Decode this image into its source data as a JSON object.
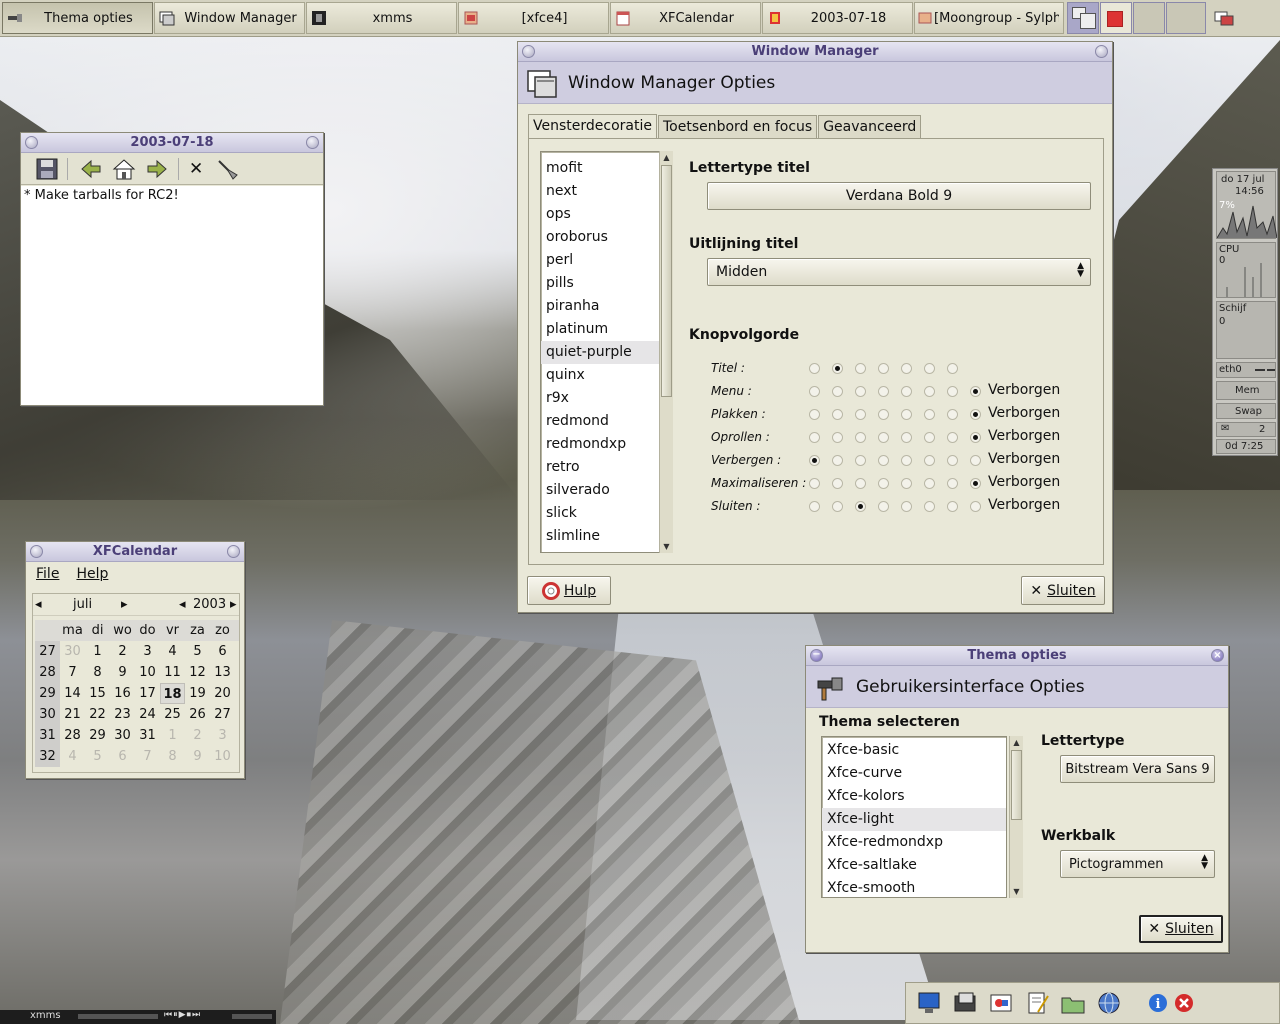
{
  "taskbar": {
    "tasks": [
      {
        "label": "Thema opties",
        "active": true
      },
      {
        "label": "Window Manager",
        "active": false
      },
      {
        "label": "xmms",
        "active": false
      },
      {
        "label": "[xfce4]",
        "active": false
      },
      {
        "label": "XFCalendar",
        "active": false
      },
      {
        "label": "2003-07-18",
        "active": false
      },
      {
        "label": "[Moongroup - Sylphe",
        "active": false
      }
    ]
  },
  "notes_window": {
    "title": "2003-07-18",
    "content": "* Make tarballs for RC2!"
  },
  "wm_window": {
    "title": "Window Manager",
    "header": "Window Manager Opties",
    "tabs": [
      "Vensterdecoratie",
      "Toetsenbord en focus",
      "Geavanceerd"
    ],
    "themes": [
      "mofit",
      "next",
      "ops",
      "oroborus",
      "perl",
      "pills",
      "piranha",
      "platinum",
      "quiet-purple",
      "quinx",
      "r9x",
      "redmond",
      "redmondxp",
      "retro",
      "silverado",
      "slick",
      "slimline"
    ],
    "selected_theme": "quiet-purple",
    "font_title_label": "Lettertype titel",
    "font_value": "Verdana Bold 9",
    "align_label": "Uitlijning titel",
    "align_value": "Midden",
    "button_order_label": "Knopvolgorde",
    "button_rows": [
      {
        "label": "Titel :",
        "selected": 1,
        "hidden_option": false
      },
      {
        "label": "Menu :",
        "selected": 7,
        "hidden_option": true
      },
      {
        "label": "Plakken :",
        "selected": 7,
        "hidden_option": true
      },
      {
        "label": "Oprollen :",
        "selected": 7,
        "hidden_option": true
      },
      {
        "label": "Verbergen :",
        "selected": 0,
        "hidden_option": true
      },
      {
        "label": "Maximaliseren :",
        "selected": 7,
        "hidden_option": true
      },
      {
        "label": "Sluiten :",
        "selected": 2,
        "hidden_option": true
      }
    ],
    "hidden_text": "Verborgen",
    "help_button": "Hulp",
    "close_button": "Sluiten"
  },
  "calendar_window": {
    "title": "XFCalendar",
    "menu": [
      "File",
      "Help"
    ],
    "month": "juli",
    "year": "2003",
    "weekday_headers": [
      "ma",
      "di",
      "wo",
      "do",
      "vr",
      "za",
      "zo"
    ],
    "weeks": [
      {
        "wk": "27",
        "days": [
          "30",
          "1",
          "2",
          "3",
          "4",
          "5",
          "6"
        ],
        "dim": [
          true,
          false,
          false,
          false,
          false,
          false,
          false
        ]
      },
      {
        "wk": "28",
        "days": [
          "7",
          "8",
          "9",
          "10",
          "11",
          "12",
          "13"
        ],
        "dim": [
          false,
          false,
          false,
          false,
          false,
          false,
          false
        ]
      },
      {
        "wk": "29",
        "days": [
          "14",
          "15",
          "16",
          "17",
          "18",
          "19",
          "20"
        ],
        "dim": [
          false,
          false,
          false,
          false,
          false,
          false,
          false
        ]
      },
      {
        "wk": "30",
        "days": [
          "21",
          "22",
          "23",
          "24",
          "25",
          "26",
          "27"
        ],
        "dim": [
          false,
          false,
          false,
          false,
          false,
          false,
          false
        ]
      },
      {
        "wk": "31",
        "days": [
          "28",
          "29",
          "30",
          "31",
          "1",
          "2",
          "3"
        ],
        "dim": [
          false,
          false,
          false,
          false,
          true,
          true,
          true
        ]
      },
      {
        "wk": "32",
        "days": [
          "4",
          "5",
          "6",
          "7",
          "8",
          "9",
          "10"
        ],
        "dim": [
          true,
          true,
          true,
          true,
          true,
          true,
          true
        ]
      }
    ],
    "today": "18"
  },
  "theme_window": {
    "title": "Thema opties",
    "header": "Gebruikersinterface Opties",
    "select_label": "Thema selecteren",
    "themes": [
      "Xfce-basic",
      "Xfce-curve",
      "Xfce-kolors",
      "Xfce-light",
      "Xfce-redmondxp",
      "Xfce-saltlake",
      "Xfce-smooth"
    ],
    "selected_theme": "Xfce-light",
    "font_label": "Lettertype",
    "font_value": "Bitstream Vera Sans 9",
    "toolbar_label": "Werkbalk",
    "toolbar_value": "Pictogrammen",
    "close_button": "Sluiten"
  },
  "gkrellm": {
    "date": "do  17 jul",
    "time": "14:56",
    "cpu_percent_label": "7%",
    "cpu_label": "CPU",
    "cpu_value": "0",
    "disk_label": "Schijf",
    "disk_value": "0",
    "net_label": "eth0",
    "mem_label": "Mem",
    "swap_label": "Swap",
    "mail_count": "2",
    "uptime": "0d  7:25"
  },
  "xmms_bar": {
    "title": "xmms"
  },
  "colors": {
    "titlebar": "#c9c7dd",
    "title_text": "#4b3f78",
    "window_bg": "#e9e8d8",
    "header_bg": "#cfcde0"
  }
}
